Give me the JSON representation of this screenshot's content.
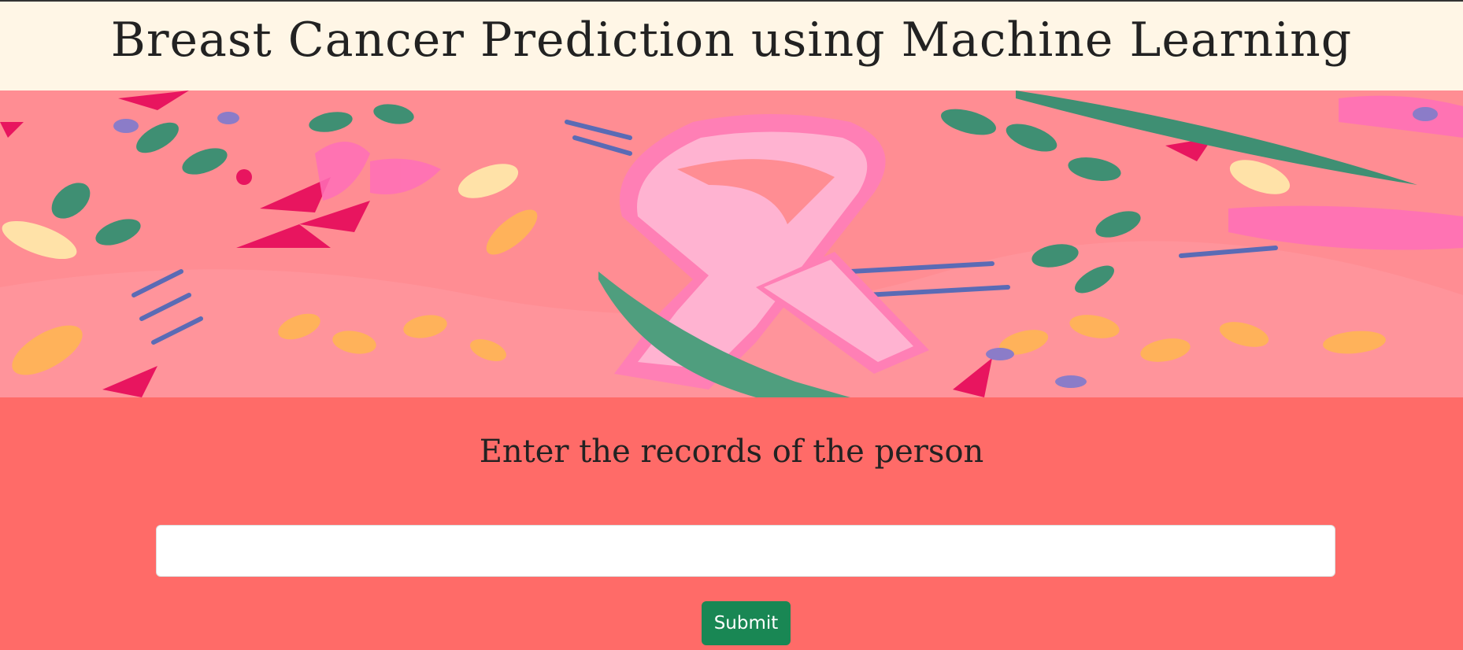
{
  "header": {
    "title": "Breast Cancer Prediction using Machine Learning"
  },
  "banner": {
    "icon": "pink-ribbon-floral-illustration"
  },
  "form": {
    "title": "Enter the records of the person",
    "input_value": "",
    "input_placeholder": "",
    "submit_label": "Submit"
  },
  "colors": {
    "header_bg": "#fff6e6",
    "banner_bg": "#ff8d93",
    "section_bg": "#ff6b68",
    "button_bg": "#198754",
    "ribbon": "#ffb3d1"
  }
}
